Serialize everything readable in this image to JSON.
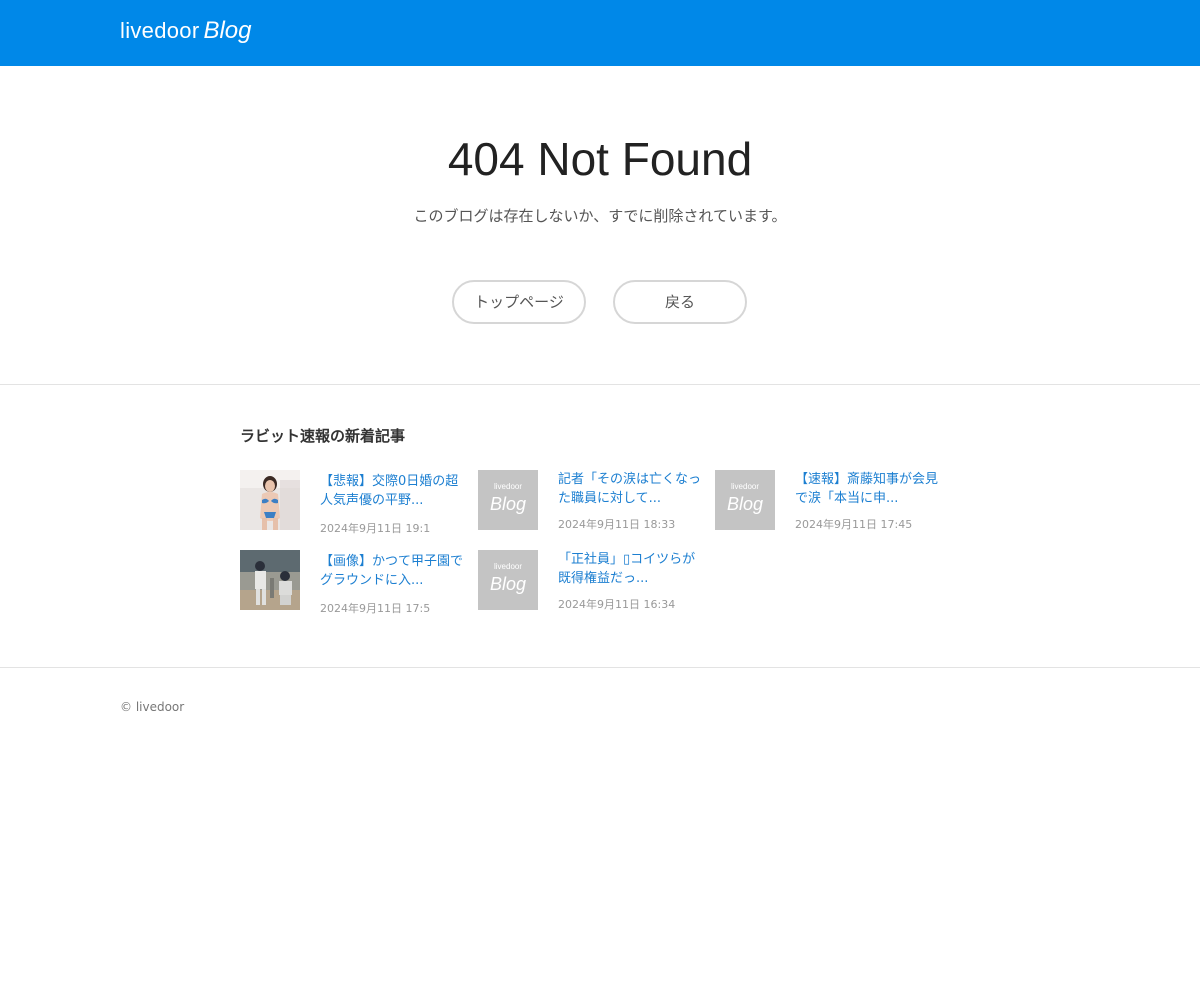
{
  "header": {
    "logo_livedoor": "livedoor",
    "logo_blog": "Blog",
    "bg_color": "#0088e8"
  },
  "error": {
    "title": "404 Not Found",
    "description": "このブログは存在しないか、すでに削除されています。"
  },
  "buttons": {
    "top_page": "トップページ",
    "back": "戻る"
  },
  "recent": {
    "title": "ラビット速報の新着記事",
    "placeholder_small": "livedoor",
    "placeholder_big": "Blog",
    "articles": [
      {
        "title": "【悲報】交際0日婚の超人気声優の平野...",
        "date": "2024年9月11日 19:1",
        "thumb": "photo-swimsuit"
      },
      {
        "title": "記者「その涙は亡くなった職員に対して...",
        "date": "2024年9月11日 18:33",
        "thumb": "placeholder"
      },
      {
        "title": "【速報】斎藤知事が会見で涙「本当に申...",
        "date": "2024年9月11日 17:45",
        "thumb": "placeholder"
      },
      {
        "title": "【画像】かつて甲子園でグラウンドに入...",
        "date": "2024年9月11日 17:5",
        "thumb": "photo-baseball"
      },
      {
        "title": "「正社員」▯コイツらが既得権益だっ...",
        "date": "2024年9月11日 16:34",
        "thumb": "placeholder"
      }
    ]
  },
  "footer": {
    "copyright": "© livedoor"
  }
}
